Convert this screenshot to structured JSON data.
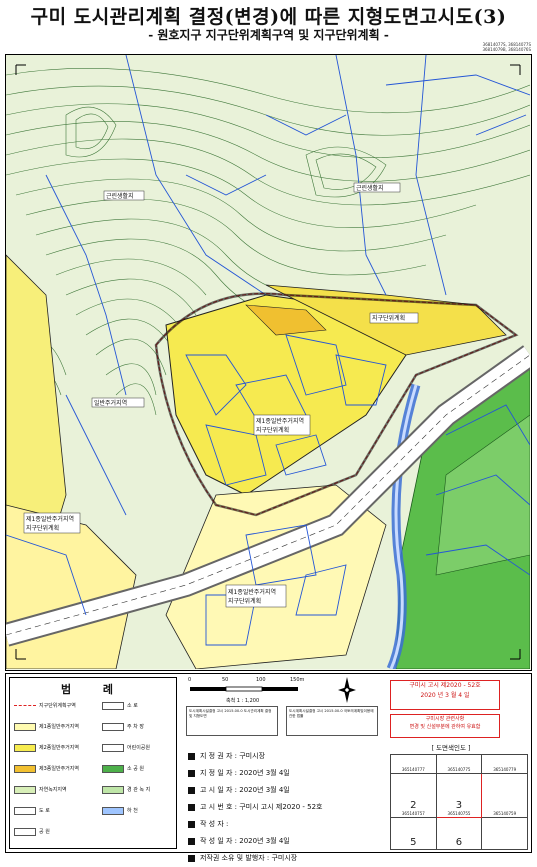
{
  "title": "구미 도시관리계획 결정(변경)에 따른 지형도면고시도(3)",
  "subtitle": "- 원호지구 지구단위계획구역 및 지구단위계획 -",
  "sheet_codes": [
    "36814077S, 36814077S",
    "36814079B, 36814076S"
  ],
  "map": {
    "labels": [
      "근린생활지",
      "근린생활지",
      "일반주거지역",
      "지구단위계획",
      "제1종일반주거지역",
      "지구단위계획",
      "제1종일반주거지역",
      "지구단위계획",
      "제1종일반주거지역",
      "지구단위계획"
    ]
  },
  "legend": {
    "title": "범 례",
    "items": [
      {
        "label": "지구단위계획구역",
        "color": "#ffffff",
        "kind": "line"
      },
      {
        "label": "제1종일반주거지역",
        "color": "#fffbb0"
      },
      {
        "label": "제2종일반주거지역",
        "color": "#f7ec4f"
      },
      {
        "label": "제3종일반주거지역",
        "color": "#f2c030"
      },
      {
        "label": "자연녹지지역",
        "color": "#d8efb8"
      },
      {
        "label": "도 로",
        "color": "#ffffff"
      },
      {
        "label": "공 원",
        "color": "#ffffff"
      }
    ],
    "items_right": [
      {
        "label": "소 로"
      },
      {
        "label": "주 차 장"
      },
      {
        "label": "어린이공원"
      },
      {
        "label": "소 공 원"
      },
      {
        "label": "경 관 녹 지"
      },
      {
        "label": "하 천"
      }
    ]
  },
  "scale": {
    "ticks": [
      "0",
      "50",
      "100",
      "150m"
    ],
    "text": "축척 1 : 1,200"
  },
  "notes": [
    "도시계획시설결정 고시 2015.00.0 도시관리계획 결정 및 지형도면",
    "도시계획시설결정 고시 2015.00.0 국토의계획및이용에관한 법률"
  ],
  "info": [
    "지 정 권 자 : 구미시장",
    "지 정 일 자 : 2020년    3월    4일",
    "고 시 일 자 : 2020년    3월    4일",
    "고 시 번 호 : 구미시 고시 제2020 - 52호",
    "작 성 자 :",
    "작 성 일 자 : 2020년    3월    4일",
    "저작권 소유 및 발행자 : 구미시장"
  ],
  "notice": {
    "line1": "구미시 고시 제2020 - 52호",
    "line2": "2020 년    3 월    4 일"
  },
  "stamp": {
    "line1": "구미시장 관련사항",
    "line2": "변경 및 신설부분에 관하여 유효함"
  },
  "index": {
    "title": "[ 도면색인도 ]",
    "rows": [
      [
        {
          "code": "365140777"
        },
        {
          "code": "365140775"
        },
        {
          "code": "365140779"
        }
      ],
      [
        {
          "code": "365140757",
          "num": "2"
        },
        {
          "code": "365140755",
          "num": "3"
        },
        {
          "code": "365140759"
        }
      ],
      [
        {
          "code": "",
          "num": "5"
        },
        {
          "code": "",
          "num": "6"
        },
        {
          "code": ""
        }
      ]
    ]
  },
  "colors": {
    "zone1": "#fffbb0",
    "zone2": "#f7ec4f",
    "green": "#5cbc4e",
    "water": "#3b6fd6",
    "contour": "#2d6f2d"
  }
}
